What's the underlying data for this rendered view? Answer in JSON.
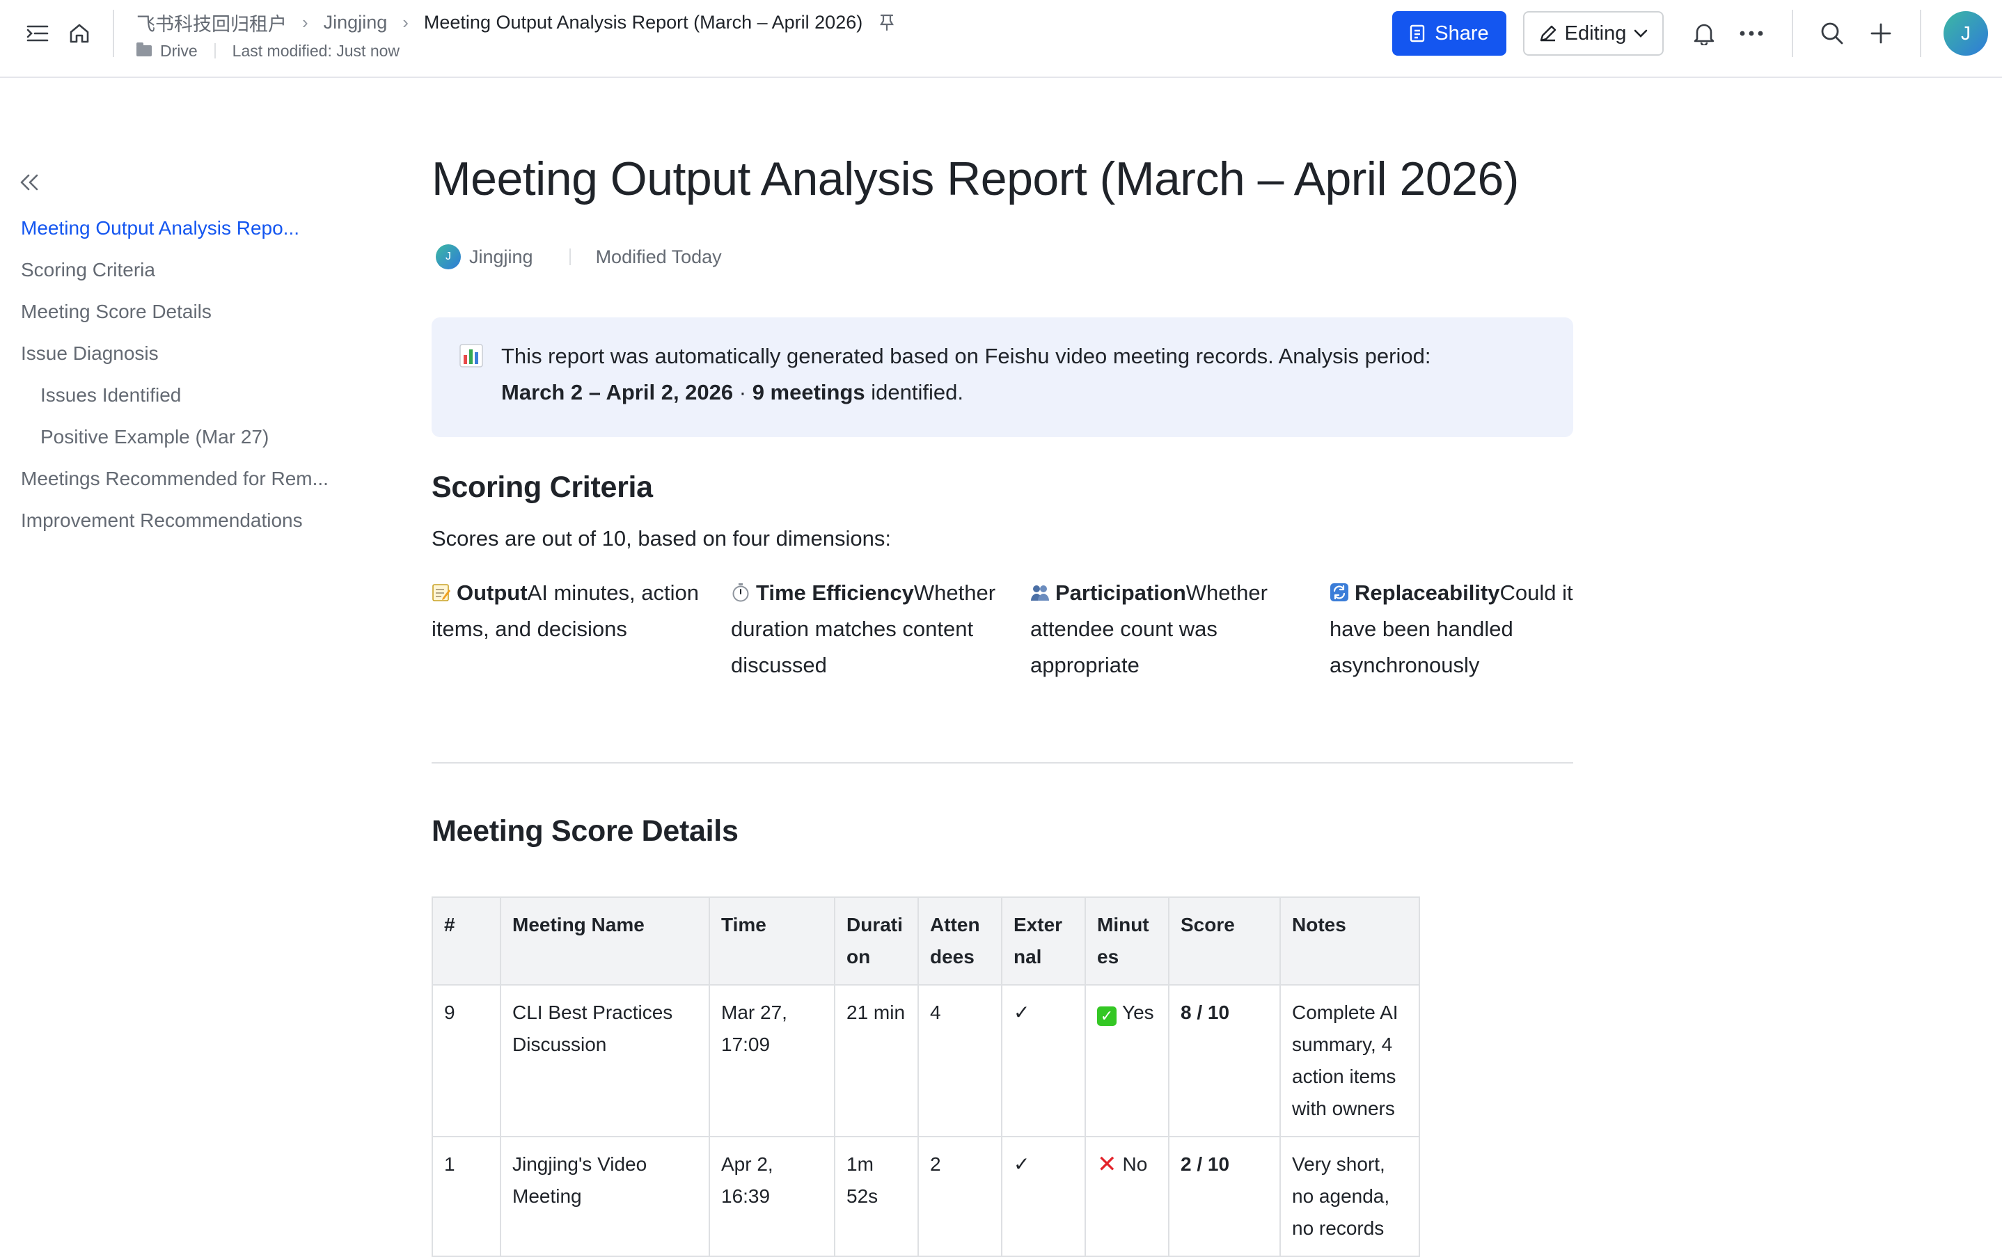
{
  "header": {
    "breadcrumbs": [
      "飞书科技回归租户",
      "Jingjing",
      "Meeting Output Analysis Report (March – April 2026)"
    ],
    "location": "Drive",
    "last_modified": "Last modified: Just now",
    "share_label": "Share",
    "mode_label": "Editing",
    "user_initial": "J",
    "icons": [
      "outline-toggle-icon",
      "home-icon",
      "pin-icon",
      "bell-icon",
      "more-icon",
      "search-icon",
      "plus-icon"
    ]
  },
  "toc": {
    "items": [
      {
        "label": "Meeting Output Analysis Repo...",
        "active": true,
        "level": 1
      },
      {
        "label": "Scoring Criteria",
        "level": 1
      },
      {
        "label": "Meeting Score Details",
        "level": 1
      },
      {
        "label": "Issue Diagnosis",
        "level": 1
      },
      {
        "label": "Issues Identified",
        "level": 2
      },
      {
        "label": "Positive Example (Mar 27)",
        "level": 2
      },
      {
        "label": "Meetings Recommended for Rem...",
        "level": 1
      },
      {
        "label": "Improvement Recommendations",
        "level": 1
      }
    ]
  },
  "doc": {
    "title": "Meeting Output Analysis Report (March – April 2026)",
    "author_initial": "J",
    "author": "Jingjing",
    "modified": "Modified Today",
    "callout": {
      "line1": "This report was automatically generated based on Feishu video meeting records. Analysis period:",
      "period": "March 2 – April 2, 2026",
      "sep": " · ",
      "count": "9 meetings",
      "suffix": " identified."
    },
    "scoring": {
      "heading": "Scoring Criteria",
      "intro": "Scores are out of 10, based on four dimensions:",
      "criteria": [
        {
          "icon": "memo-icon",
          "name": "Output",
          "desc": "AI minutes, action items, and decisions"
        },
        {
          "icon": "stopwatch-icon",
          "name": "Time Efficiency",
          "desc": "Whether duration matches content discussed"
        },
        {
          "icon": "people-icon",
          "name": "Participation",
          "desc": "Whether attendee count was appropriate"
        },
        {
          "icon": "repeat-icon",
          "name": "Replaceability",
          "desc": "Could it have been handled asynchronously"
        }
      ]
    },
    "details": {
      "heading": "Meeting Score Details",
      "columns": [
        "#",
        "Meeting Name",
        "Time",
        "Durati on",
        "Atten dees",
        "Exter nal",
        "Minut es",
        "Score",
        "Notes"
      ],
      "rows": [
        {
          "num": "9",
          "name": "CLI Best Practices Discussion",
          "time": "Mar 27, 17:09",
          "duration": "21 min",
          "attendees": "4",
          "external": "✓",
          "minutes": "Yes",
          "minutes_ok": true,
          "score": "8 / 10",
          "notes": "Complete AI summary, 4 action items with owners"
        },
        {
          "num": "1",
          "name": "Jingjing's Video Meeting",
          "time": "Apr 2, 16:39",
          "duration": "1m 52s",
          "attendees": "2",
          "external": "✓",
          "minutes": "No",
          "minutes_ok": false,
          "score": "2 / 10",
          "notes": "Very short, no agenda, no records"
        }
      ]
    }
  }
}
